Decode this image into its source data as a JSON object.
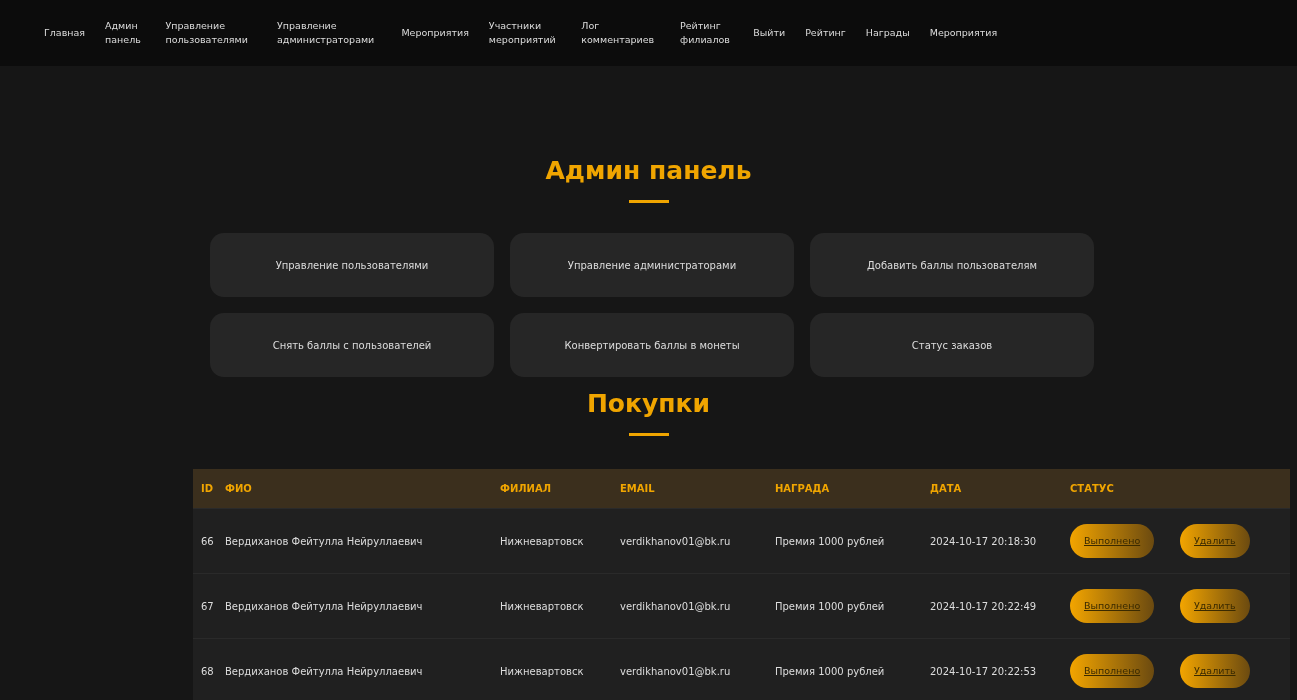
{
  "nav": [
    {
      "label": "Главная"
    },
    {
      "label": "Админ панель"
    },
    {
      "label": "Управление пользователями"
    },
    {
      "label": "Управление администраторами"
    },
    {
      "label": "Мероприятия"
    },
    {
      "label": "Участники мероприятий"
    },
    {
      "label": "Лог комментариев"
    },
    {
      "label": "Рейтинг филиалов"
    },
    {
      "label": "Выйти"
    },
    {
      "label": "Рейтинг"
    },
    {
      "label": "Награды"
    },
    {
      "label": "Мероприятия"
    }
  ],
  "title": "Админ панель",
  "actions": [
    "Управление пользователями",
    "Управление администраторами",
    "Добавить баллы пользователям",
    "Снять баллы с пользователей",
    "Конвертировать баллы в монеты",
    "Статус заказов"
  ],
  "purchases_title": "Покупки",
  "table": {
    "columns": [
      "ID",
      "ФИО",
      "ФИЛИАЛ",
      "EMAIL",
      "НАГРАДА",
      "ДАТА",
      "СТАТУС"
    ],
    "rows": [
      {
        "id": "66",
        "name": "Вердиханов Фейтулла Нейруллаевич",
        "branch": "Нижневартовск",
        "email": "verdikhanov01@bk.ru",
        "reward": "Премия 1000 рублей",
        "date": "2024-10-17 20:18:30",
        "status_button": "Выполнено",
        "delete_button": "Удалить"
      },
      {
        "id": "67",
        "name": "Вердиханов Фейтулла Нейруллаевич",
        "branch": "Нижневартовск",
        "email": "verdikhanov01@bk.ru",
        "reward": "Премия 1000 рублей",
        "date": "2024-10-17 20:22:49",
        "status_button": "Выполнено",
        "delete_button": "Удалить"
      },
      {
        "id": "68",
        "name": "Вердиханов Фейтулла Нейруллаевич",
        "branch": "Нижневартовск",
        "email": "verdikhanov01@bk.ru",
        "reward": "Премия 1000 рублей",
        "date": "2024-10-17 20:22:53",
        "status_button": "Выполнено",
        "delete_button": "Удалить"
      }
    ]
  }
}
